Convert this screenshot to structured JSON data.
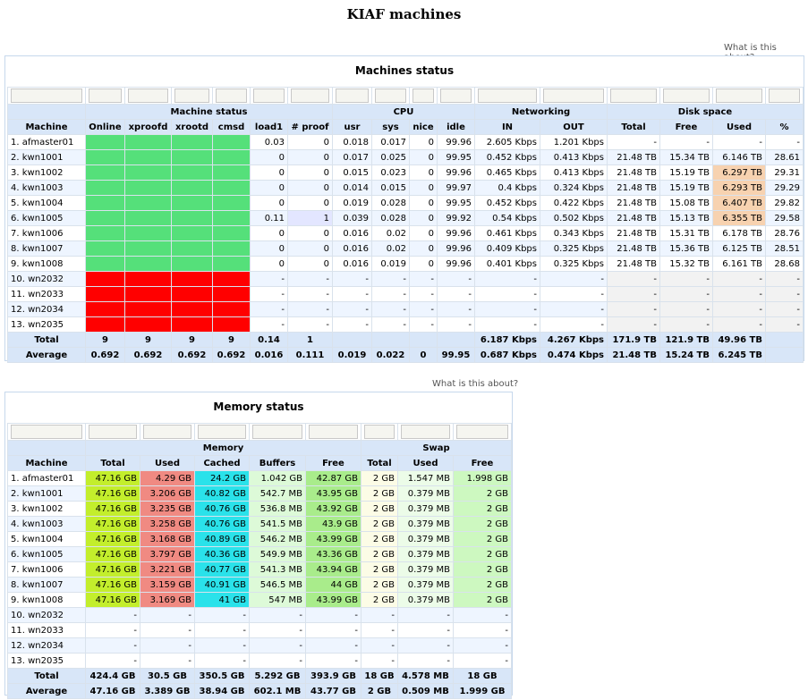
{
  "page_title": "KIAF machines",
  "about_link": "What is this about?",
  "machines": {
    "title": "Machines status",
    "group_headers": {
      "status": "Machine status",
      "cpu": "CPU",
      "net": "Networking",
      "disk": "Disk space"
    },
    "columns": [
      "Machine",
      "Online",
      "xproofd",
      "xrootd",
      "cmsd",
      "load1",
      "# proof",
      "usr",
      "sys",
      "nice",
      "idle",
      "IN",
      "OUT",
      "Total",
      "Free",
      "Used",
      "%"
    ],
    "rows": [
      [
        "1. afmaster01",
        "",
        "",
        "",
        "",
        "0.03",
        "0",
        "0.018",
        "0.017",
        "0",
        "99.96",
        "2.605 Kbps",
        "1.201 Kbps",
        "-",
        "-",
        "-",
        "-"
      ],
      [
        "2. kwn1001",
        "",
        "",
        "",
        "",
        "0",
        "0",
        "0.017",
        "0.025",
        "0",
        "99.95",
        "0.452 Kbps",
        "0.413 Kbps",
        "21.48 TB",
        "15.34 TB",
        "6.146 TB",
        "28.61"
      ],
      [
        "3. kwn1002",
        "",
        "",
        "",
        "",
        "0",
        "0",
        "0.015",
        "0.023",
        "0",
        "99.96",
        "0.465 Kbps",
        "0.413 Kbps",
        "21.48 TB",
        "15.19 TB",
        "6.297 TB",
        "29.31"
      ],
      [
        "4. kwn1003",
        "",
        "",
        "",
        "",
        "0",
        "0",
        "0.014",
        "0.015",
        "0",
        "99.97",
        "0.4 Kbps",
        "0.324 Kbps",
        "21.48 TB",
        "15.19 TB",
        "6.293 TB",
        "29.29"
      ],
      [
        "5. kwn1004",
        "",
        "",
        "",
        "",
        "0",
        "0",
        "0.019",
        "0.028",
        "0",
        "99.95",
        "0.452 Kbps",
        "0.422 Kbps",
        "21.48 TB",
        "15.08 TB",
        "6.407 TB",
        "29.82"
      ],
      [
        "6. kwn1005",
        "",
        "",
        "",
        "",
        "0.11",
        "1",
        "0.039",
        "0.028",
        "0",
        "99.92",
        "0.54 Kbps",
        "0.502 Kbps",
        "21.48 TB",
        "15.13 TB",
        "6.355 TB",
        "29.58"
      ],
      [
        "7. kwn1006",
        "",
        "",
        "",
        "",
        "0",
        "0",
        "0.016",
        "0.02",
        "0",
        "99.96",
        "0.461 Kbps",
        "0.343 Kbps",
        "21.48 TB",
        "15.31 TB",
        "6.178 TB",
        "28.76"
      ],
      [
        "8. kwn1007",
        "",
        "",
        "",
        "",
        "0",
        "0",
        "0.016",
        "0.02",
        "0",
        "99.96",
        "0.409 Kbps",
        "0.325 Kbps",
        "21.48 TB",
        "15.36 TB",
        "6.125 TB",
        "28.51"
      ],
      [
        "9. kwn1008",
        "",
        "",
        "",
        "",
        "0",
        "0",
        "0.016",
        "0.019",
        "0",
        "99.96",
        "0.401 Kbps",
        "0.325 Kbps",
        "21.48 TB",
        "15.32 TB",
        "6.161 TB",
        "28.68"
      ],
      [
        "10. wn2032",
        "",
        "",
        "",
        "",
        "-",
        "-",
        "-",
        "-",
        "-",
        "-",
        "-",
        "-",
        "-",
        "-",
        "-",
        "-"
      ],
      [
        "11. wn2033",
        "",
        "",
        "",
        "",
        "-",
        "-",
        "-",
        "-",
        "-",
        "-",
        "-",
        "-",
        "-",
        "-",
        "-",
        "-"
      ],
      [
        "12. wn2034",
        "",
        "",
        "",
        "",
        "-",
        "-",
        "-",
        "-",
        "-",
        "-",
        "-",
        "-",
        "-",
        "-",
        "-",
        "-"
      ],
      [
        "13. wn2035",
        "",
        "",
        "",
        "",
        "-",
        "-",
        "-",
        "-",
        "-",
        "-",
        "-",
        "-",
        "-",
        "-",
        "-",
        "-"
      ]
    ],
    "total": [
      "Total",
      "9",
      "9",
      "9",
      "9",
      "0.14",
      "1",
      "",
      "",
      "",
      "",
      "6.187 Kbps",
      "4.267 Kbps",
      "171.9 TB",
      "121.9 TB",
      "49.96 TB",
      ""
    ],
    "average": [
      "Average",
      "0.692",
      "0.692",
      "0.692",
      "0.692",
      "0.016",
      "0.111",
      "0.019",
      "0.022",
      "0",
      "99.95",
      "0.687 Kbps",
      "0.474 Kbps",
      "21.48 TB",
      "15.24 TB",
      "6.245 TB",
      ""
    ],
    "status_colors": {
      "online": "#55e07a",
      "offline": "#ff0000"
    }
  },
  "memory": {
    "title": "Memory status",
    "group_headers": {
      "memory": "Memory",
      "swap": "Swap"
    },
    "columns": [
      "Machine",
      "Total",
      "Used",
      "Cached",
      "Buffers",
      "Free",
      "Total",
      "Used",
      "Free"
    ],
    "rows": [
      [
        "1. afmaster01",
        "47.16 GB",
        "4.29 GB",
        "24.2 GB",
        "1.042 GB",
        "42.87 GB",
        "2 GB",
        "1.547 MB",
        "1.998 GB"
      ],
      [
        "2. kwn1001",
        "47.16 GB",
        "3.206 GB",
        "40.82 GB",
        "542.7 MB",
        "43.95 GB",
        "2 GB",
        "0.379 MB",
        "2 GB"
      ],
      [
        "3. kwn1002",
        "47.16 GB",
        "3.235 GB",
        "40.76 GB",
        "536.8 MB",
        "43.92 GB",
        "2 GB",
        "0.379 MB",
        "2 GB"
      ],
      [
        "4. kwn1003",
        "47.16 GB",
        "3.258 GB",
        "40.76 GB",
        "541.5 MB",
        "43.9 GB",
        "2 GB",
        "0.379 MB",
        "2 GB"
      ],
      [
        "5. kwn1004",
        "47.16 GB",
        "3.168 GB",
        "40.89 GB",
        "546.2 MB",
        "43.99 GB",
        "2 GB",
        "0.379 MB",
        "2 GB"
      ],
      [
        "6. kwn1005",
        "47.16 GB",
        "3.797 GB",
        "40.36 GB",
        "549.9 MB",
        "43.36 GB",
        "2 GB",
        "0.379 MB",
        "2 GB"
      ],
      [
        "7. kwn1006",
        "47.16 GB",
        "3.221 GB",
        "40.77 GB",
        "541.3 MB",
        "43.94 GB",
        "2 GB",
        "0.379 MB",
        "2 GB"
      ],
      [
        "8. kwn1007",
        "47.16 GB",
        "3.159 GB",
        "40.91 GB",
        "546.5 MB",
        "44 GB",
        "2 GB",
        "0.379 MB",
        "2 GB"
      ],
      [
        "9. kwn1008",
        "47.16 GB",
        "3.169 GB",
        "41 GB",
        "547 MB",
        "43.99 GB",
        "2 GB",
        "0.379 MB",
        "2 GB"
      ],
      [
        "10. wn2032",
        "-",
        "-",
        "-",
        "-",
        "-",
        "-",
        "-",
        "-"
      ],
      [
        "11. wn2033",
        "-",
        "-",
        "-",
        "-",
        "-",
        "-",
        "-",
        "-"
      ],
      [
        "12. wn2034",
        "-",
        "-",
        "-",
        "-",
        "-",
        "-",
        "-",
        "-"
      ],
      [
        "13. wn2035",
        "-",
        "-",
        "-",
        "-",
        "-",
        "-",
        "-",
        "-"
      ]
    ],
    "total": [
      "Total",
      "424.4 GB",
      "30.5 GB",
      "350.5 GB",
      "5.292 GB",
      "393.9 GB",
      "18 GB",
      "4.578 MB",
      "18 GB"
    ],
    "average": [
      "Average",
      "47.16 GB",
      "3.389 GB",
      "38.94 GB",
      "602.1 MB",
      "43.77 GB",
      "2 GB",
      "0.509 MB",
      "1.999 GB"
    ]
  }
}
